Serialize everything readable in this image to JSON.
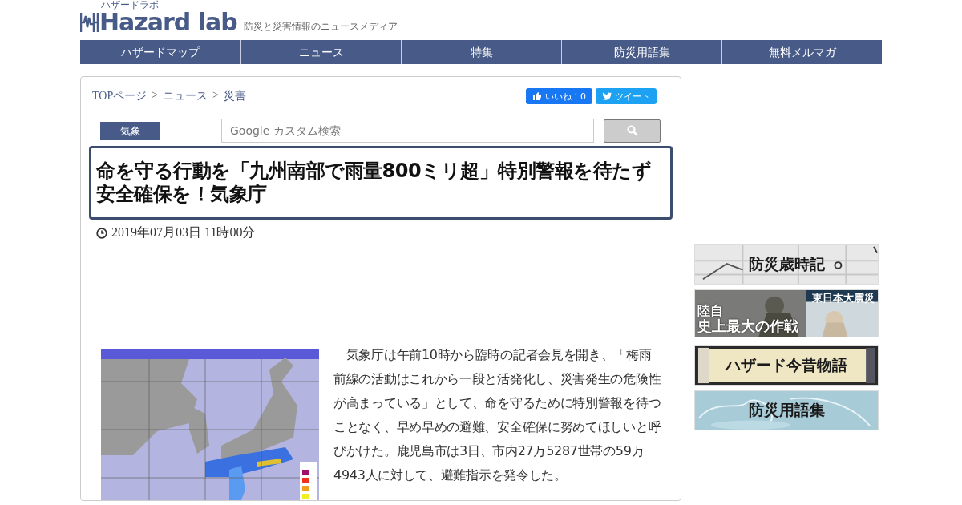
{
  "logo": {
    "text": "Hazard lab",
    "kana": "ハザードラボ",
    "tagline": "防災と災害情報のニュースメディア"
  },
  "nav": [
    {
      "label": "ハザードマップ"
    },
    {
      "label": "ニュース"
    },
    {
      "label": "特集"
    },
    {
      "label": "防災用語集"
    },
    {
      "label": "無料メルマガ"
    }
  ],
  "breadcrumb": [
    "TOPページ",
    "ニュース",
    "災害"
  ],
  "breadcrumb_separator": ">",
  "social": {
    "like": "いいね！0",
    "tweet": "ツイート"
  },
  "category": "気象",
  "search": {
    "placeholder": "Google カスタム検索"
  },
  "article": {
    "title": "命を守る行動を「九州南部で雨量800ミリ超」特別警報を待たず安全確保を！気象庁",
    "date": "2019年07月03日 11時00分",
    "body": "　気象庁は午前10時から臨時の記者会見を開き、「梅雨前線の活動はこれから一段と活発化し、災害発生の危険性が高まっている」として、命を守るために特別警報を待つことなく、早め早めの避難、安全確保に努めてほしいと呼びかけた。鹿児島市は3日、市内27万5287世帯の59万4943人に対して、避難指示を発令した。"
  },
  "banners": [
    {
      "kind": "calendar",
      "labels": [
        "防災歳時記"
      ]
    },
    {
      "labels": [
        "東日本大震災",
        "陸自",
        "史上最大の作戦"
      ]
    },
    {
      "kind": "scroll",
      "labels": [
        "ハザード今昔物語"
      ]
    },
    {
      "kind": "sky",
      "labels": [
        "防災用語集"
      ]
    }
  ]
}
